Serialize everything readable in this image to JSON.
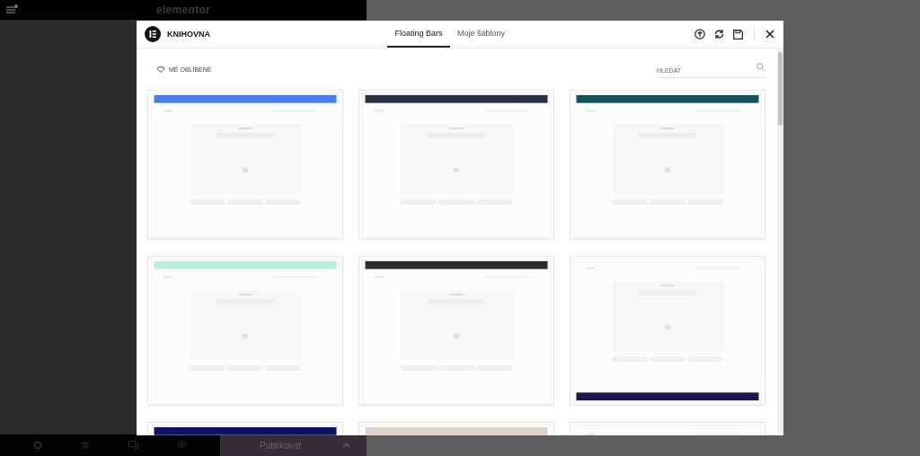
{
  "editor": {
    "logo": "elementor",
    "publish_button": "Publikovat"
  },
  "library": {
    "title": "KNIHOVNA",
    "tabs": [
      {
        "label": "Floating Bars",
        "selected": true
      },
      {
        "label": "Moje šablony",
        "selected": false
      }
    ],
    "favorites": "MÉ OBLÍBENÉ",
    "search": {
      "placeholder": "HLEDAT"
    }
  }
}
